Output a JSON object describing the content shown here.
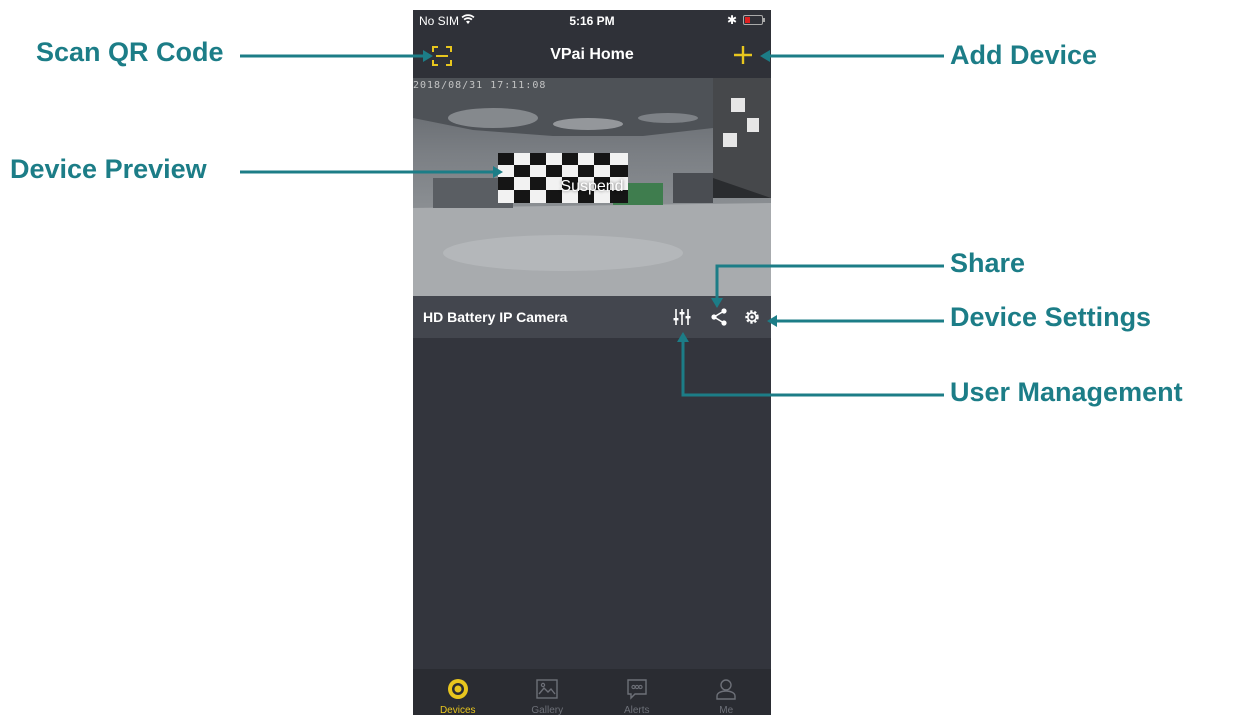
{
  "status_bar": {
    "carrier": "No SIM",
    "time": "5:16 PM"
  },
  "nav": {
    "title": "VPai Home",
    "left_icon": "qr-scan-icon",
    "right_icon": "plus-icon"
  },
  "preview": {
    "timestamp": "2018/08/31 17:11:08",
    "status": "Suspend"
  },
  "device": {
    "name": "HD Battery IP Camera",
    "actions": [
      "user-management-icon",
      "share-icon",
      "settings-icon"
    ]
  },
  "tabs": [
    {
      "label": "Devices",
      "icon": "devices-icon",
      "active": true
    },
    {
      "label": "Gallery",
      "icon": "gallery-icon",
      "active": false
    },
    {
      "label": "Alerts",
      "icon": "alerts-icon",
      "active": false
    },
    {
      "label": "Me",
      "icon": "profile-icon",
      "active": false
    }
  ],
  "callouts": {
    "scan_qr": "Scan QR Code",
    "device_preview": "Device Preview",
    "add_device": "Add Device",
    "share": "Share",
    "device_settings": "Device Settings",
    "user_management": "User Management"
  },
  "colors": {
    "accent": "#e8c61e",
    "callout": "#1c7d87",
    "background": "#33353d"
  }
}
